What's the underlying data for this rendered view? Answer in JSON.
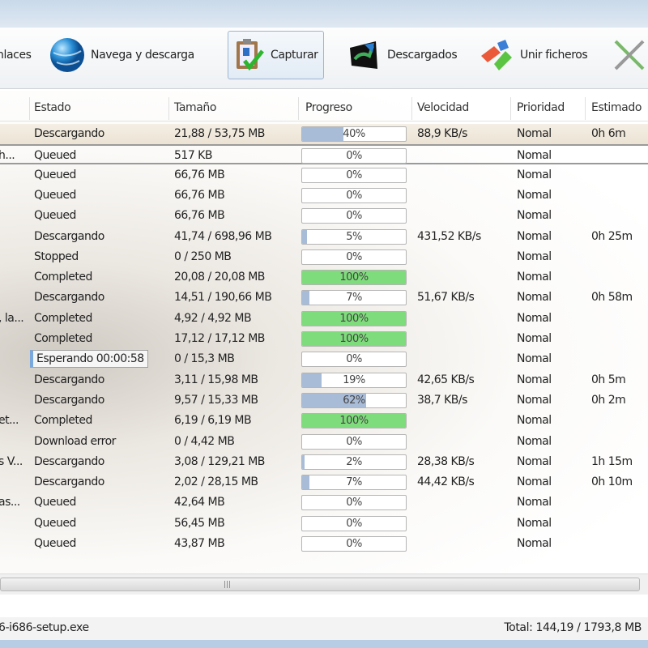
{
  "toolbar": {
    "items": [
      {
        "label": "nlaces",
        "icon": "links-icon"
      },
      {
        "label": "Navega y descarga",
        "icon": "globe-icon"
      },
      {
        "label": "Capturar",
        "icon": "clipboard-check-icon",
        "active": true
      },
      {
        "label": "Descargados",
        "icon": "downloaded-icon"
      },
      {
        "label": "Unir ficheros",
        "icon": "join-files-icon"
      },
      {
        "label": "",
        "icon": "tools-icon"
      }
    ]
  },
  "columns": {
    "estado": "Estado",
    "tamano": "Tamaño",
    "progreso": "Progreso",
    "velocidad": "Velocidad",
    "prioridad": "Prioridad",
    "estimado": "Estimado"
  },
  "colors": {
    "progress": "#a8bcd8",
    "complete": "#7fdc7c"
  },
  "rows": [
    {
      "name": "",
      "estado": "Descargando",
      "tamano": "21,88 / 53,75 MB",
      "progress": 40,
      "progress_label": "40%",
      "velocidad": "88,9 KB/s",
      "prioridad": "Nomal",
      "estimado": "0h 6m",
      "selected": true
    },
    {
      "name": "h...",
      "estado": "Queued",
      "tamano": "517 KB",
      "progress": 0,
      "progress_label": "0%",
      "velocidad": "",
      "prioridad": "Nomal",
      "estimado": "",
      "focused": true
    },
    {
      "name": "",
      "estado": "Queued",
      "tamano": "66,76 MB",
      "progress": 0,
      "progress_label": "0%",
      "velocidad": "",
      "prioridad": "Nomal",
      "estimado": ""
    },
    {
      "name": "",
      "estado": "Queued",
      "tamano": "66,76 MB",
      "progress": 0,
      "progress_label": "0%",
      "velocidad": "",
      "prioridad": "Nomal",
      "estimado": ""
    },
    {
      "name": "",
      "estado": "Queued",
      "tamano": "66,76 MB",
      "progress": 0,
      "progress_label": "0%",
      "velocidad": "",
      "prioridad": "Nomal",
      "estimado": ""
    },
    {
      "name": "",
      "estado": "Descargando",
      "tamano": "41,74 / 698,96 MB",
      "progress": 5,
      "progress_label": "5%",
      "velocidad": "431,52 KB/s",
      "prioridad": "Nomal",
      "estimado": "0h 25m"
    },
    {
      "name": "",
      "estado": "Stopped",
      "tamano": "0 / 250 MB",
      "progress": 0,
      "progress_label": "0%",
      "velocidad": "",
      "prioridad": "Nomal",
      "estimado": ""
    },
    {
      "name": "",
      "estado": "Completed",
      "tamano": "20,08 / 20,08 MB",
      "progress": 100,
      "progress_label": "100%",
      "velocidad": "",
      "prioridad": "Nomal",
      "estimado": ""
    },
    {
      "name": "",
      "estado": "Descargando",
      "tamano": "14,51 / 190,66 MB",
      "progress": 7,
      "progress_label": "7%",
      "velocidad": "51,67 KB/s",
      "prioridad": "Nomal",
      "estimado": "0h 58m"
    },
    {
      "name": ", la...",
      "estado": "Completed",
      "tamano": "4,92 / 4,92 MB",
      "progress": 100,
      "progress_label": "100%",
      "velocidad": "",
      "prioridad": "Nomal",
      "estimado": ""
    },
    {
      "name": "",
      "estado": "Completed",
      "tamano": "17,12 / 17,12 MB",
      "progress": 100,
      "progress_label": "100%",
      "velocidad": "",
      "prioridad": "Nomal",
      "estimado": ""
    },
    {
      "name": "",
      "estado": "Esperando 00:00:58",
      "tamano": "0 / 15,3 MB",
      "progress": 0,
      "progress_label": "0%",
      "velocidad": "",
      "prioridad": "Nomal",
      "estimado": "",
      "waiting": true
    },
    {
      "name": "",
      "estado": "Descargando",
      "tamano": "3,11 / 15,98 MB",
      "progress": 19,
      "progress_label": "19%",
      "velocidad": "42,65 KB/s",
      "prioridad": "Nomal",
      "estimado": "0h 5m"
    },
    {
      "name": "",
      "estado": "Descargando",
      "tamano": "9,57 / 15,33 MB",
      "progress": 62,
      "progress_label": "62%",
      "velocidad": "38,7 KB/s",
      "prioridad": "Nomal",
      "estimado": "0h 2m"
    },
    {
      "name": "et...",
      "estado": "Completed",
      "tamano": "6,19 / 6,19 MB",
      "progress": 100,
      "progress_label": "100%",
      "velocidad": "",
      "prioridad": "Nomal",
      "estimado": ""
    },
    {
      "name": "",
      "estado": "Download error",
      "tamano": "0 / 4,42 MB",
      "progress": 0,
      "progress_label": "0%",
      "velocidad": "",
      "prioridad": "Nomal",
      "estimado": ""
    },
    {
      "name": "s V...",
      "estado": "Descargando",
      "tamano": "3,08 / 129,21 MB",
      "progress": 2,
      "progress_label": "2%",
      "velocidad": "28,38 KB/s",
      "prioridad": "Nomal",
      "estimado": "1h 15m"
    },
    {
      "name": "",
      "estado": "Descargando",
      "tamano": "2,02 / 28,15 MB",
      "progress": 7,
      "progress_label": "7%",
      "velocidad": "44,42 KB/s",
      "prioridad": "Nomal",
      "estimado": "0h 10m"
    },
    {
      "name": "as...",
      "estado": "Queued",
      "tamano": "42,64 MB",
      "progress": 0,
      "progress_label": "0%",
      "velocidad": "",
      "prioridad": "Nomal",
      "estimado": ""
    },
    {
      "name": "",
      "estado": "Queued",
      "tamano": "56,45 MB",
      "progress": 0,
      "progress_label": "0%",
      "velocidad": "",
      "prioridad": "Nomal",
      "estimado": ""
    },
    {
      "name": "",
      "estado": "Queued",
      "tamano": "43,87 MB",
      "progress": 0,
      "progress_label": "0%",
      "velocidad": "",
      "prioridad": "Nomal",
      "estimado": ""
    }
  ],
  "status": {
    "file": "6-i686-setup.exe",
    "total": "Total: 144,19 / 1793,8 MB"
  }
}
